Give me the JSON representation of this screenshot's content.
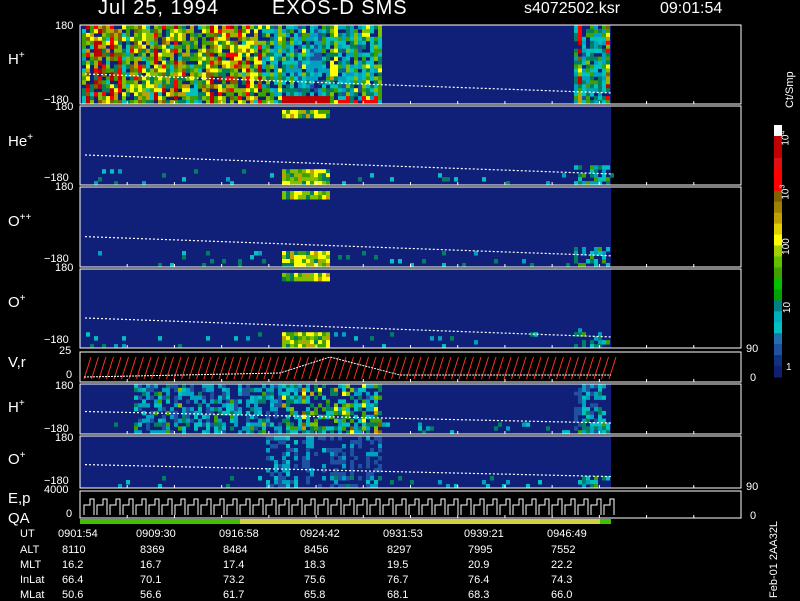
{
  "header": {
    "date": "Jul 25, 1994",
    "instrument": "EXOS-D SMS",
    "file": "s4072502.ksr",
    "time": "09:01:54"
  },
  "panels": {
    "h_plus": "H",
    "he_plus": "He",
    "o_plusplus": "O",
    "o_plus": "O",
    "vr": "V,r",
    "h_plus2": "H",
    "o_plus2": "O",
    "ep": "E,p",
    "qa": "QA"
  },
  "superscripts": {
    "plus": "+",
    "plusplus": "++"
  },
  "ticks": {
    "p180": "180",
    "m180": "−180",
    "t25": "25",
    "t0": "0",
    "t4000": "4000",
    "t90": "90"
  },
  "colorbar": {
    "unit": "Ct/Smp",
    "labels": [
      "10^4",
      "10^3",
      "100",
      "10",
      "1"
    ],
    "colors": [
      "#ffffff",
      "#c00000",
      "#e01010",
      "#ff0000",
      "#806000",
      "#a08000",
      "#c0a000",
      "#ffff00",
      "#80c000",
      "#40a000",
      "#00c000",
      "#008080",
      "#00c0c0",
      "#2050a0",
      "#102080"
    ]
  },
  "table": {
    "rows": [
      {
        "label": "UT",
        "values": [
          "0901:54",
          "0909:30",
          "0916:58",
          "0924:42",
          "0931:53",
          "0939:21",
          "0946:49"
        ]
      },
      {
        "label": "ALT",
        "values": [
          "8110",
          "8369",
          "8484",
          "8456",
          "8297",
          "7995",
          "7552"
        ]
      },
      {
        "label": "MLT",
        "values": [
          "16.2",
          "16.7",
          "17.4",
          "18.3",
          "19.5",
          "20.9",
          "22.2"
        ]
      },
      {
        "label": "InLat",
        "values": [
          "66.4",
          "70.1",
          "73.2",
          "75.6",
          "76.7",
          "76.4",
          "74.3"
        ]
      },
      {
        "label": "MLat",
        "values": [
          "50.6",
          "56.6",
          "61.7",
          "65.8",
          "68.1",
          "68.3",
          "66.0"
        ]
      }
    ]
  },
  "footer": {
    "stamp": "Feb-01 2AA32L"
  },
  "chart_data": {
    "type": "heatmap",
    "title": "Jul 25, 1994 EXOS-D SMS",
    "x_ticks": [
      "0901:54",
      "0909:30",
      "0916:58",
      "0924:42",
      "0931:53",
      "0939:21",
      "0946:49"
    ],
    "color_scale": "log",
    "color_range": [
      1,
      10000
    ],
    "color_unit": "Ct/Smp",
    "series": [
      {
        "name": "H+",
        "ylim": [
          -180,
          180
        ]
      },
      {
        "name": "He+",
        "ylim": [
          -180,
          180
        ]
      },
      {
        "name": "O++",
        "ylim": [
          -180,
          180
        ]
      },
      {
        "name": "O+",
        "ylim": [
          -180,
          180
        ]
      },
      {
        "name": "V,r",
        "ylim": [
          0,
          25
        ],
        "right_ticks": [
          0,
          90
        ]
      },
      {
        "name": "H+",
        "ylim": [
          -180,
          180
        ]
      },
      {
        "name": "O+",
        "ylim": [
          -180,
          180
        ]
      },
      {
        "name": "E,p",
        "ylim": [
          0,
          4000
        ],
        "right_ticks": [
          0,
          90
        ]
      }
    ]
  }
}
